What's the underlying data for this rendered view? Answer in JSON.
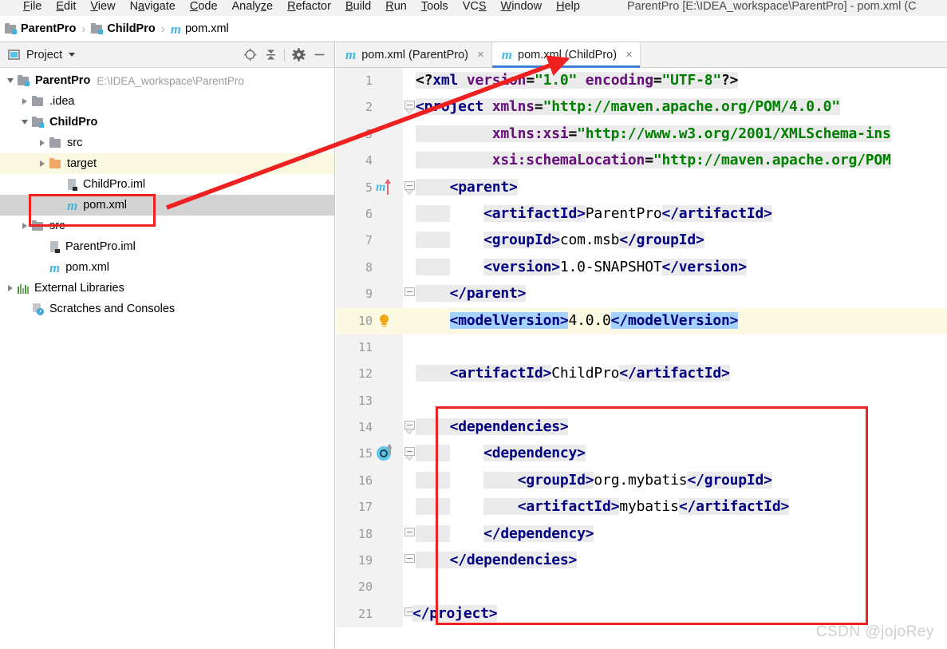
{
  "window": {
    "title": "ParentPro [E:\\IDEA_workspace\\ParentPro] - pom.xml (C"
  },
  "menubar": {
    "items": [
      {
        "label": "File"
      },
      {
        "label": "Edit"
      },
      {
        "label": "View"
      },
      {
        "label": "Navigate"
      },
      {
        "label": "Code"
      },
      {
        "label": "Analyze"
      },
      {
        "label": "Refactor"
      },
      {
        "label": "Build"
      },
      {
        "label": "Run"
      },
      {
        "label": "Tools"
      },
      {
        "label": "VCS"
      },
      {
        "label": "Window"
      },
      {
        "label": "Help"
      }
    ]
  },
  "breadcrumb": {
    "items": [
      {
        "label": "ParentPro",
        "icon": "module-icon"
      },
      {
        "label": "ChildPro",
        "icon": "module-icon"
      },
      {
        "label": "pom.xml",
        "icon": "maven-icon"
      }
    ],
    "separator": "›"
  },
  "project_panel": {
    "title": "Project",
    "title_icon": "project-icon",
    "dropdown_icon": "chevron-down-icon",
    "tools": [
      {
        "name": "locate-icon"
      },
      {
        "name": "collapse-all-icon"
      },
      {
        "name": "gear-icon"
      },
      {
        "name": "minimize-icon"
      }
    ],
    "tree": [
      {
        "label": "ParentPro",
        "path": "E:\\IDEA_workspace\\ParentPro",
        "icon": "module-icon",
        "indent": 0,
        "arrow": "down",
        "bold": true,
        "state": "normal"
      },
      {
        "label": ".idea",
        "path": "",
        "icon": "folder-icon",
        "indent": 1,
        "arrow": "right",
        "bold": false,
        "state": "normal"
      },
      {
        "label": "ChildPro",
        "path": "",
        "icon": "module-icon",
        "indent": 1,
        "arrow": "down",
        "bold": true,
        "state": "normal"
      },
      {
        "label": "src",
        "path": "",
        "icon": "folder-icon",
        "indent": 2,
        "arrow": "right",
        "bold": false,
        "state": "normal"
      },
      {
        "label": "target",
        "path": "",
        "icon": "folder-orange-icon",
        "indent": 2,
        "arrow": "right",
        "bold": false,
        "state": "highlight"
      },
      {
        "label": "ChildPro.iml",
        "path": "",
        "icon": "iml-icon",
        "indent": 3,
        "arrow": "none",
        "bold": false,
        "state": "normal"
      },
      {
        "label": "pom.xml",
        "path": "",
        "icon": "maven-icon",
        "indent": 3,
        "arrow": "none",
        "bold": false,
        "state": "selected"
      },
      {
        "label": "src",
        "path": "",
        "icon": "folder-icon",
        "indent": 1,
        "arrow": "right",
        "bold": false,
        "state": "normal"
      },
      {
        "label": "ParentPro.iml",
        "path": "",
        "icon": "iml-icon",
        "indent": 2,
        "arrow": "none",
        "bold": false,
        "state": "normal"
      },
      {
        "label": "pom.xml",
        "path": "",
        "icon": "maven-icon",
        "indent": 2,
        "arrow": "none",
        "bold": false,
        "state": "normal"
      },
      {
        "label": "External Libraries",
        "path": "",
        "icon": "libraries-icon",
        "indent": 0,
        "arrow": "right",
        "bold": false,
        "state": "normal"
      },
      {
        "label": "Scratches and Consoles",
        "path": "",
        "icon": "scratches-icon",
        "indent": 0,
        "arrow": "none",
        "bold": false,
        "state": "normal"
      }
    ]
  },
  "editor": {
    "tabs": [
      {
        "label": "pom.xml (ParentPro)",
        "icon": "maven-icon",
        "active": false,
        "close": "×"
      },
      {
        "label": "pom.xml (ChildPro)",
        "icon": "maven-icon",
        "active": true,
        "close": "×"
      }
    ],
    "lines": [
      {
        "n": "1",
        "gutter": "none",
        "fold": "none"
      },
      {
        "n": "2",
        "gutter": "none",
        "fold": "start"
      },
      {
        "n": "3",
        "gutter": "none",
        "fold": "none"
      },
      {
        "n": "4",
        "gutter": "none",
        "fold": "none"
      },
      {
        "n": "5",
        "gutter": "maven-parent-icon",
        "fold": "start"
      },
      {
        "n": "6",
        "gutter": "none",
        "fold": "none"
      },
      {
        "n": "7",
        "gutter": "none",
        "fold": "none"
      },
      {
        "n": "8",
        "gutter": "none",
        "fold": "none"
      },
      {
        "n": "9",
        "gutter": "none",
        "fold": "end"
      },
      {
        "n": "10",
        "gutter": "lightbulb-icon",
        "fold": "none",
        "current": true
      },
      {
        "n": "11",
        "gutter": "none",
        "fold": "none"
      },
      {
        "n": "12",
        "gutter": "none",
        "fold": "none"
      },
      {
        "n": "13",
        "gutter": "none",
        "fold": "none"
      },
      {
        "n": "14",
        "gutter": "none",
        "fold": "start"
      },
      {
        "n": "15",
        "gutter": "override-icon",
        "fold": "start"
      },
      {
        "n": "16",
        "gutter": "none",
        "fold": "none"
      },
      {
        "n": "17",
        "gutter": "none",
        "fold": "none"
      },
      {
        "n": "18",
        "gutter": "none",
        "fold": "end"
      },
      {
        "n": "19",
        "gutter": "none",
        "fold": "end"
      },
      {
        "n": "20",
        "gutter": "none",
        "fold": "none"
      },
      {
        "n": "21",
        "gutter": "none",
        "fold": "end"
      }
    ],
    "code": [
      "<?xml version=\"1.0\" encoding=\"UTF-8\"?>",
      "<project xmlns=\"http://maven.apache.org/POM/4.0.0\"",
      "         xmlns:xsi=\"http://www.w3.org/2001/XMLSchema-ins",
      "         xsi:schemaLocation=\"http://maven.apache.org/POM",
      "    <parent>",
      "        <artifactId>ParentPro</artifactId>",
      "        <groupId>com.msb</groupId>",
      "        <version>1.0-SNAPSHOT</version>",
      "    </parent>",
      "    <modelVersion>4.0.0</modelVersion>",
      "",
      "    <artifactId>ChildPro</artifactId>",
      "",
      "    <dependencies>",
      "        <dependency>",
      "            <groupId>org.mybatis</groupId>",
      "            <artifactId>mybatis</artifactId>",
      "        </dependency>",
      "    </dependencies>",
      "",
      "</project>"
    ]
  },
  "annotations": {
    "rect_pom_xml": {
      "label": "highlight-box-pom-xml"
    },
    "rect_dependencies": {
      "label": "highlight-box-dependencies"
    },
    "arrow": {
      "label": "pointer-arrow-to-childpro-tab"
    },
    "color": "#ef2020"
  },
  "watermark": {
    "text": "CSDN @jojoRey"
  }
}
